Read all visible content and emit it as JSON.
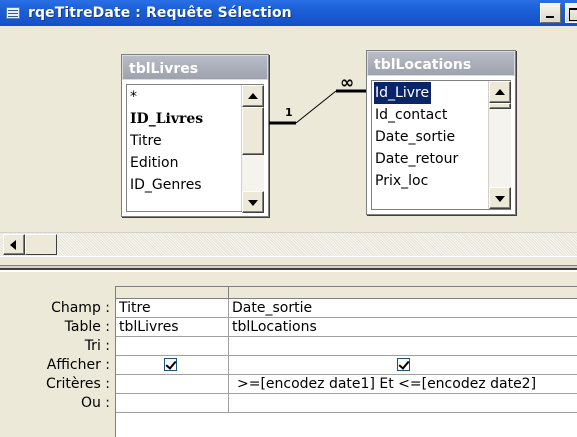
{
  "window": {
    "title": "rqeTitreDate : Requête Sélection"
  },
  "tables": [
    {
      "name": "tblLivres",
      "fields": [
        "*",
        "ID_Livres",
        "Titre",
        "Edition",
        "ID_Genres"
      ]
    },
    {
      "name": "tblLocations",
      "fields": [
        "Id_Livre",
        "Id_contact",
        "Date_sortie",
        "Date_retour",
        "Prix_loc"
      ]
    }
  ],
  "relationship": {
    "one_label": "1",
    "many_label": "∞"
  },
  "grid": {
    "row_labels": {
      "champ": "Champ :",
      "table": "Table :",
      "tri": "Tri :",
      "afficher": "Afficher :",
      "criteres": "Critères :",
      "ou": "Ou :"
    },
    "columns": [
      {
        "champ": "Titre",
        "table": "tblLivres",
        "tri": "",
        "afficher": true,
        "criteres": "",
        "ou": ""
      },
      {
        "champ": "Date_sortie",
        "table": "tblLocations",
        "tri": "",
        "afficher": true,
        "criteres": ">=[encodez date1] Et <=[encodez date2]",
        "ou": ""
      }
    ]
  },
  "colors": {
    "titlebar": "#1b5fd6",
    "selection": "#0a246a",
    "pane_background": "#ece9d8"
  }
}
